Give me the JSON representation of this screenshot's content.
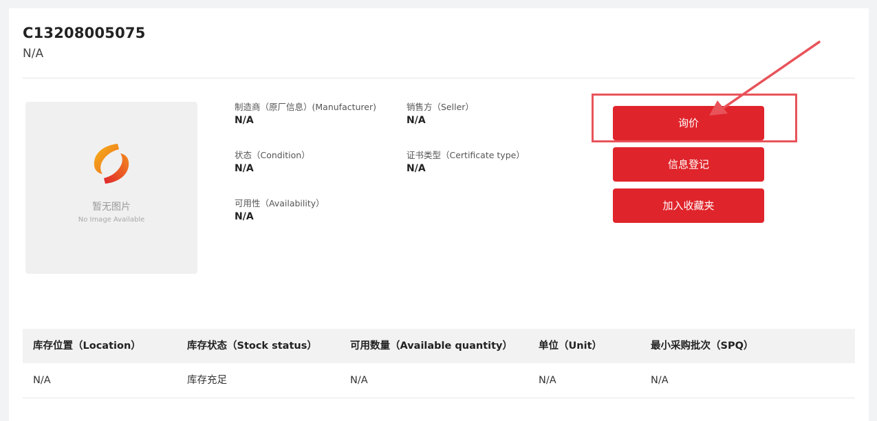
{
  "product": {
    "part_number": "C13208005075",
    "subtitle": "N/A"
  },
  "image_placeholder": {
    "icon": "brand-swirl-logo-icon",
    "text_cn": "暂无图片",
    "text_en": "No Image Available"
  },
  "attributes": {
    "manufacturer": {
      "label": "制造商（原厂信息）(Manufacturer)",
      "value": "N/A"
    },
    "seller": {
      "label": "销售方（Seller）",
      "value": "N/A"
    },
    "condition": {
      "label": "状态（Condition）",
      "value": "N/A"
    },
    "certificate_type": {
      "label": "证书类型（Certificate type）",
      "value": "N/A"
    },
    "availability": {
      "label": "可用性（Availability）",
      "value": "N/A"
    }
  },
  "actions": {
    "inquiry_label": "询价",
    "register_label": "信息登记",
    "favorite_label": "加入收藏夹"
  },
  "stock_table": {
    "headers": [
      "库存位置（Location）",
      "库存状态（Stock status）",
      "可用数量（Available quantity）",
      "单位（Unit）",
      "最小采购批次（SPQ）"
    ],
    "rows": [
      [
        "N/A",
        "库存充足",
        "N/A",
        "N/A",
        "N/A"
      ]
    ]
  },
  "colors": {
    "accent": "#e0242b",
    "highlight": "#e8535a"
  }
}
